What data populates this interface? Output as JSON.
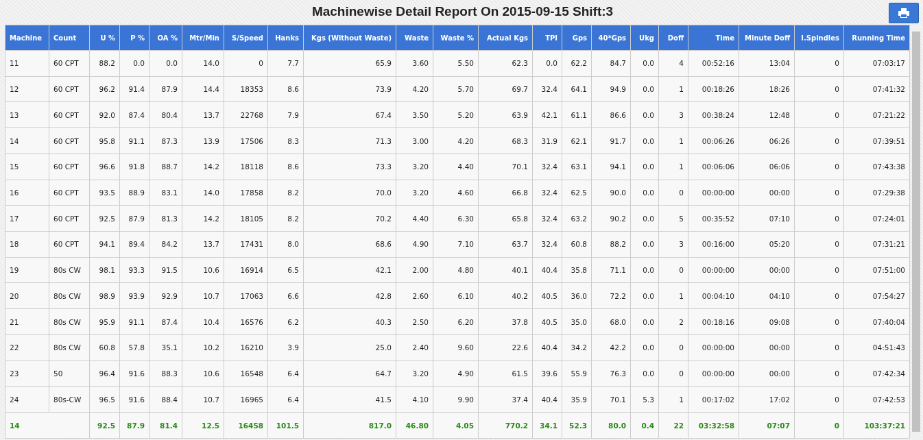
{
  "title": "Machinewise Detail Report On 2015-09-15 Shift:3",
  "table": {
    "columns": [
      "Machine",
      "Count",
      "U %",
      "P %",
      "OA %",
      "Mtr/Min",
      "S/Speed",
      "Hanks",
      "Kgs (Without Waste)",
      "Waste",
      "Waste %",
      "Actual Kgs",
      "TPI",
      "Gps",
      "40*Gps",
      "Ukg",
      "Doff",
      "Time",
      "Minute Doff",
      "I.Spindles",
      "Running Time"
    ],
    "rows": [
      [
        "11",
        "60 CPT",
        "88.2",
        "0.0",
        "0.0",
        "14.0",
        "0",
        "7.7",
        "65.9",
        "3.60",
        "5.50",
        "62.3",
        "0.0",
        "62.2",
        "84.7",
        "0.0",
        "4",
        "00:52:16",
        "13:04",
        "0",
        "07:03:17"
      ],
      [
        "12",
        "60 CPT",
        "96.2",
        "91.4",
        "87.9",
        "14.4",
        "18353",
        "8.6",
        "73.9",
        "4.20",
        "5.70",
        "69.7",
        "32.4",
        "64.1",
        "94.9",
        "0.0",
        "1",
        "00:18:26",
        "18:26",
        "0",
        "07:41:32"
      ],
      [
        "13",
        "60 CPT",
        "92.0",
        "87.4",
        "80.4",
        "13.7",
        "22768",
        "7.9",
        "67.4",
        "3.50",
        "5.20",
        "63.9",
        "42.1",
        "61.1",
        "86.6",
        "0.0",
        "3",
        "00:38:24",
        "12:48",
        "0",
        "07:21:22"
      ],
      [
        "14",
        "60 CPT",
        "95.8",
        "91.1",
        "87.3",
        "13.9",
        "17506",
        "8.3",
        "71.3",
        "3.00",
        "4.20",
        "68.3",
        "31.9",
        "62.1",
        "91.7",
        "0.0",
        "1",
        "00:06:26",
        "06:26",
        "0",
        "07:39:51"
      ],
      [
        "15",
        "60 CPT",
        "96.6",
        "91.8",
        "88.7",
        "14.2",
        "18118",
        "8.6",
        "73.3",
        "3.20",
        "4.40",
        "70.1",
        "32.4",
        "63.1",
        "94.1",
        "0.0",
        "1",
        "00:06:06",
        "06:06",
        "0",
        "07:43:38"
      ],
      [
        "16",
        "60 CPT",
        "93.5",
        "88.9",
        "83.1",
        "14.0",
        "17858",
        "8.2",
        "70.0",
        "3.20",
        "4.60",
        "66.8",
        "32.4",
        "62.5",
        "90.0",
        "0.0",
        "0",
        "00:00:00",
        "00:00",
        "0",
        "07:29:38"
      ],
      [
        "17",
        "60 CPT",
        "92.5",
        "87.9",
        "81.3",
        "14.2",
        "18105",
        "8.2",
        "70.2",
        "4.40",
        "6.30",
        "65.8",
        "32.4",
        "63.2",
        "90.2",
        "0.0",
        "5",
        "00:35:52",
        "07:10",
        "0",
        "07:24:01"
      ],
      [
        "18",
        "60 CPT",
        "94.1",
        "89.4",
        "84.2",
        "13.7",
        "17431",
        "8.0",
        "68.6",
        "4.90",
        "7.10",
        "63.7",
        "32.4",
        "60.8",
        "88.2",
        "0.0",
        "3",
        "00:16:00",
        "05:20",
        "0",
        "07:31:21"
      ],
      [
        "19",
        "80s CW",
        "98.1",
        "93.3",
        "91.5",
        "10.6",
        "16914",
        "6.5",
        "42.1",
        "2.00",
        "4.80",
        "40.1",
        "40.4",
        "35.8",
        "71.1",
        "0.0",
        "0",
        "00:00:00",
        "00:00",
        "0",
        "07:51:00"
      ],
      [
        "20",
        "80s CW",
        "98.9",
        "93.9",
        "92.9",
        "10.7",
        "17063",
        "6.6",
        "42.8",
        "2.60",
        "6.10",
        "40.2",
        "40.5",
        "36.0",
        "72.2",
        "0.0",
        "1",
        "00:04:10",
        "04:10",
        "0",
        "07:54:27"
      ],
      [
        "21",
        "80s CW",
        "95.9",
        "91.1",
        "87.4",
        "10.4",
        "16576",
        "6.2",
        "40.3",
        "2.50",
        "6.20",
        "37.8",
        "40.5",
        "35.0",
        "68.0",
        "0.0",
        "2",
        "00:18:16",
        "09:08",
        "0",
        "07:40:04"
      ],
      [
        "22",
        "80s CW",
        "60.8",
        "57.8",
        "35.1",
        "10.2",
        "16210",
        "3.9",
        "25.0",
        "2.40",
        "9.60",
        "22.6",
        "40.4",
        "34.2",
        "42.2",
        "0.0",
        "0",
        "00:00:00",
        "00:00",
        "0",
        "04:51:43"
      ],
      [
        "23",
        "50",
        "96.4",
        "91.6",
        "88.3",
        "10.6",
        "16548",
        "6.4",
        "64.7",
        "3.20",
        "4.90",
        "61.5",
        "39.6",
        "55.9",
        "76.3",
        "0.0",
        "0",
        "00:00:00",
        "00:00",
        "0",
        "07:42:34"
      ],
      [
        "24",
        "80s-CW",
        "96.5",
        "91.6",
        "88.4",
        "10.7",
        "16965",
        "6.4",
        "41.5",
        "4.10",
        "9.90",
        "37.4",
        "40.4",
        "35.9",
        "70.1",
        "5.3",
        "1",
        "00:17:02",
        "17:02",
        "0",
        "07:42:53"
      ]
    ],
    "total": [
      "14",
      "92.5",
      "87.9",
      "81.4",
      "12.5",
      "16458",
      "101.5",
      "817.0",
      "46.80",
      "4.05",
      "770.2",
      "34.1",
      "52.3",
      "80.0",
      "0.4",
      "22",
      "03:32:58",
      "07:07",
      "0",
      "103:37:21"
    ]
  }
}
